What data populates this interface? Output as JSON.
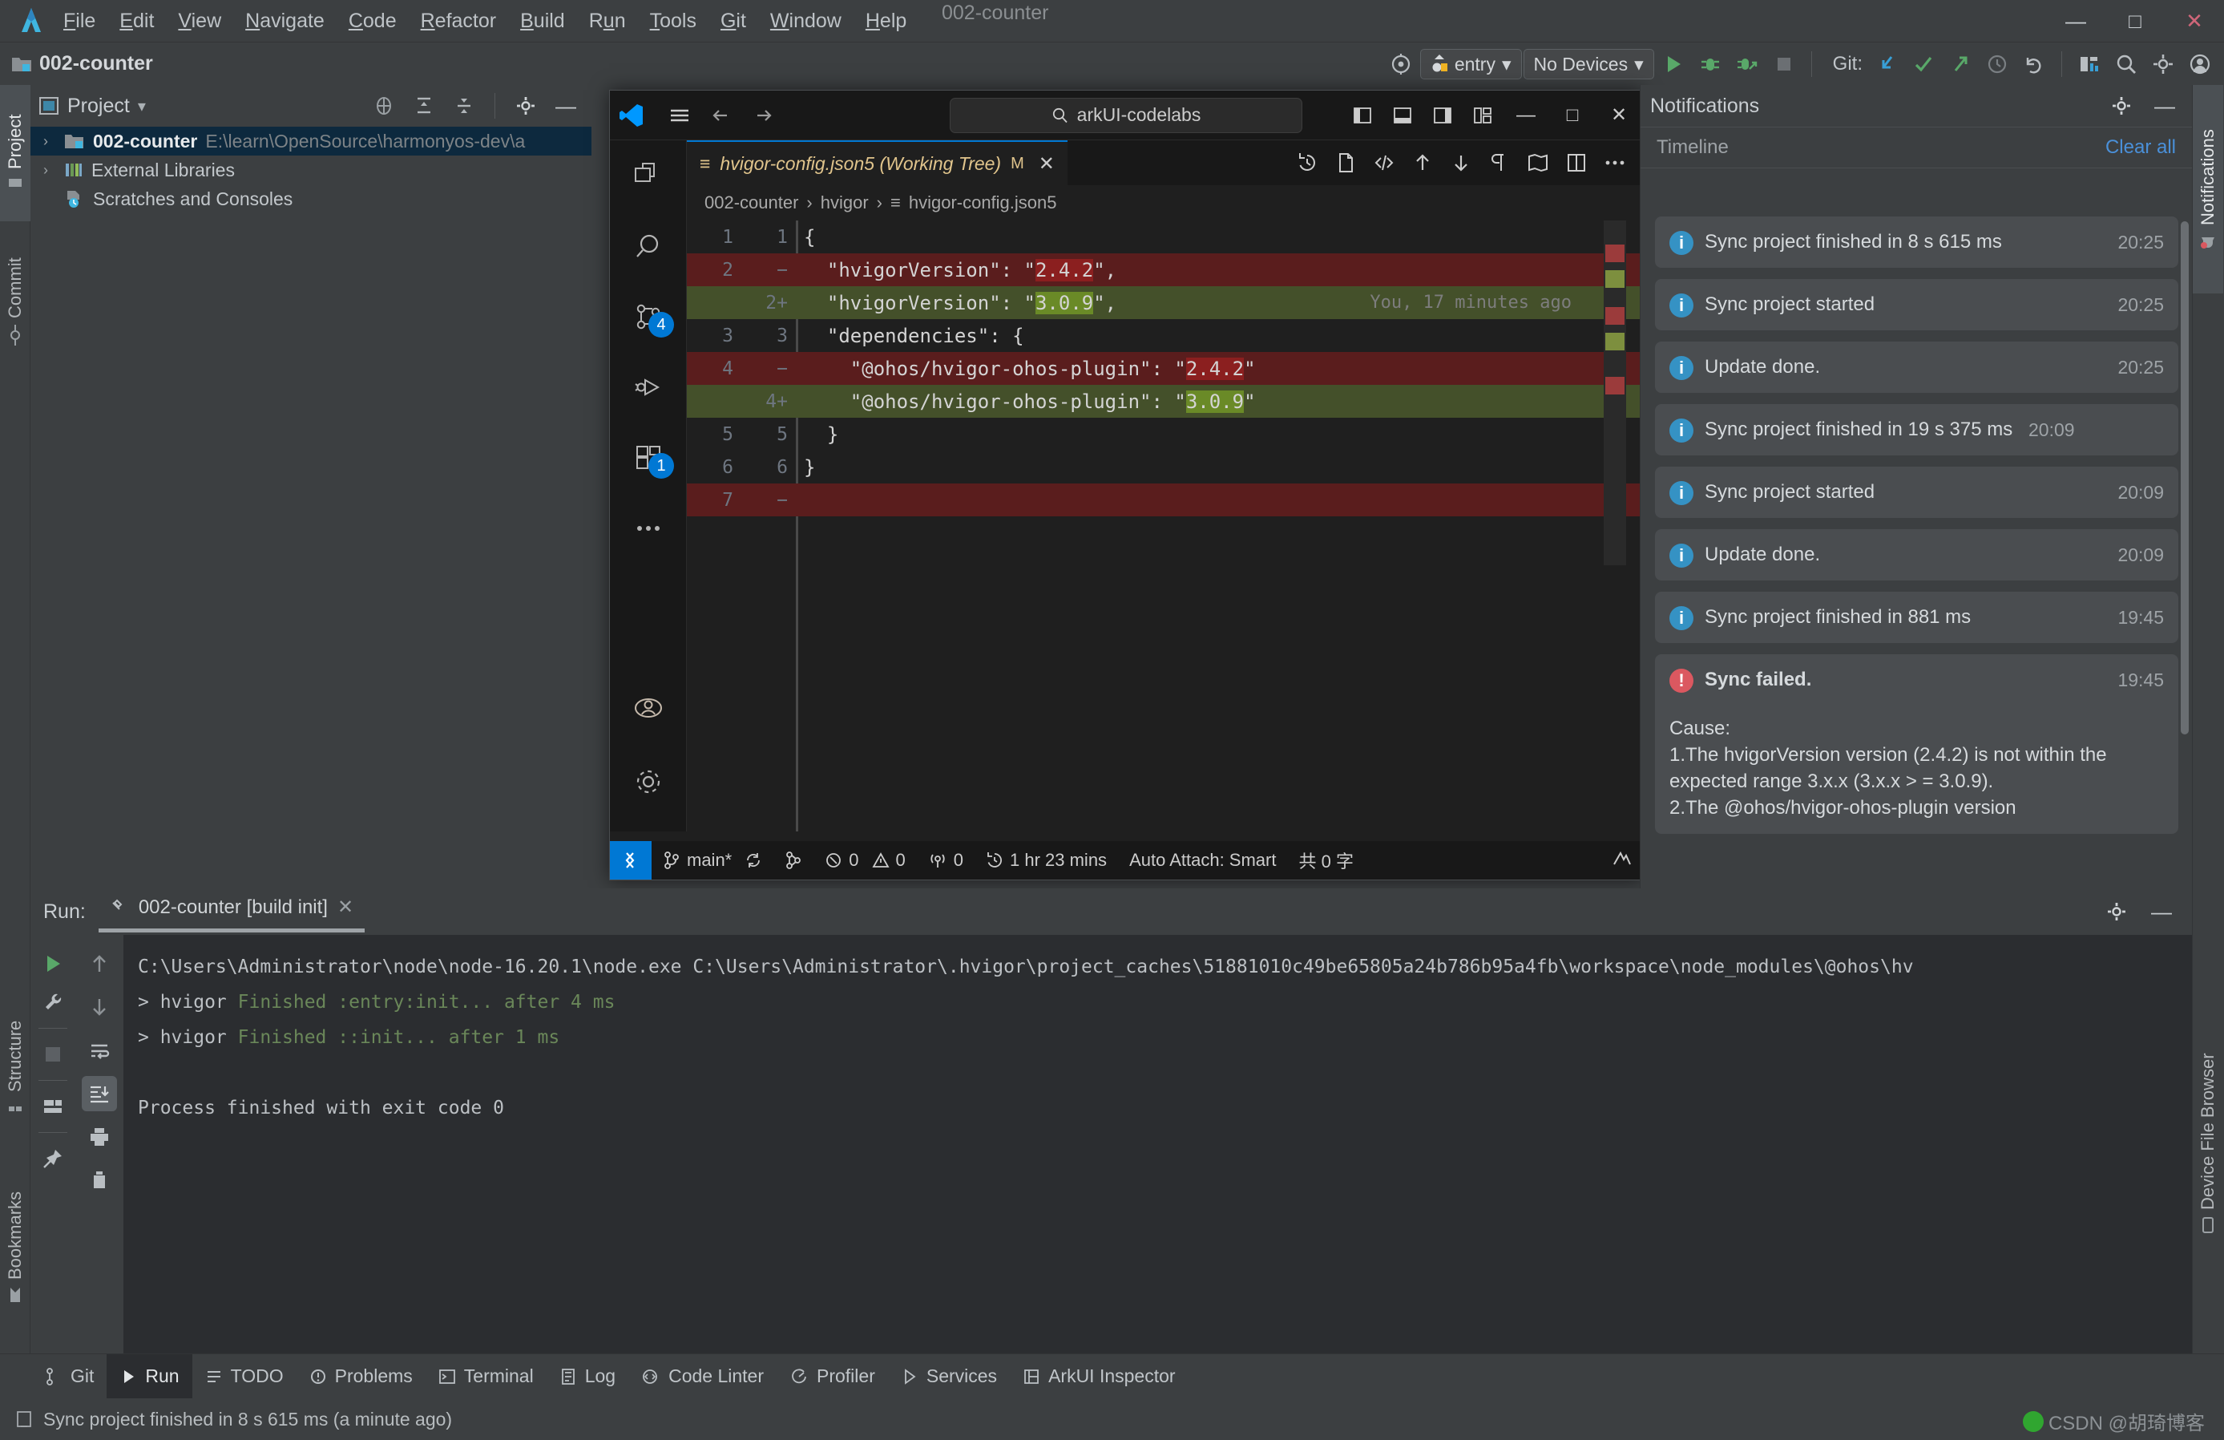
{
  "ide": {
    "menu": [
      "File",
      "Edit",
      "View",
      "Navigate",
      "Code",
      "Refactor",
      "Build",
      "Run",
      "Tools",
      "Git",
      "Window",
      "Help"
    ],
    "window_title": "002-counter",
    "project_chip": "002-counter",
    "toolbar": {
      "target_selector": "entry",
      "device_selector": "No Devices",
      "git_label": "Git:"
    },
    "left_tabs": [
      "Project",
      "Commit",
      "Structure",
      "Bookmarks"
    ],
    "right_tabs": [
      "Notifications",
      "Device File Browser"
    ]
  },
  "project_panel": {
    "title": "Project",
    "tree": [
      {
        "label": "002-counter",
        "path": "E:\\learn\\OpenSource\\harmonyos-dev\\a",
        "selected": true,
        "chevron": "›"
      },
      {
        "label": "External Libraries",
        "path": "",
        "selected": false,
        "chevron": "›"
      },
      {
        "label": "Scratches and Consoles",
        "path": "",
        "selected": false,
        "chevron": ""
      }
    ]
  },
  "vscode": {
    "search_value": "arkUI-codelabs",
    "tab": {
      "label": "hvigor-config.json5 (Working Tree)",
      "modified_flag": "M",
      "close": "✕"
    },
    "breadcrumb": [
      "002-counter",
      "hvigor",
      "hvigor-config.json5"
    ],
    "activity_badges": {
      "source_control": "4",
      "extensions": "1"
    },
    "diff": [
      {
        "old": "1",
        "new": "1",
        "type": "ctx",
        "text": "{"
      },
      {
        "old": "2",
        "new": "−",
        "type": "del",
        "pre": "  \"hvigorVersion\": \"",
        "hl": "2.4.2",
        "post": "\","
      },
      {
        "old": "",
        "new": "2+",
        "type": "add",
        "pre": "  \"hvigorVersion\": \"",
        "hl": "3.0.9",
        "post": "\",",
        "blame": "You, 17 minutes ago"
      },
      {
        "old": "3",
        "new": "3",
        "type": "ctx",
        "text": "  \"dependencies\": {"
      },
      {
        "old": "4",
        "new": "−",
        "type": "del",
        "pre": "    \"@ohos/hvigor-ohos-plugin\": \"",
        "hl": "2.4.2",
        "post": "\""
      },
      {
        "old": "",
        "new": "4+",
        "type": "add",
        "pre": "    \"@ohos/hvigor-ohos-plugin\": \"",
        "hl": "3.0.9",
        "post": "\""
      },
      {
        "old": "5",
        "new": "5",
        "type": "ctx",
        "text": "  }"
      },
      {
        "old": "6",
        "new": "6",
        "type": "ctx",
        "text": "}"
      },
      {
        "old": "7",
        "new": "−",
        "type": "del",
        "pre": "",
        "hl": "",
        "post": ""
      }
    ],
    "status": {
      "branch": "main*",
      "errors": "0",
      "warnings": "0",
      "ports": "0",
      "timer": "1 hr 23 mins",
      "auto_attach": "Auto Attach: Smart",
      "char_count": "共 0 字"
    }
  },
  "notifications": {
    "title": "Notifications",
    "section": "Timeline",
    "clear_all": "Clear all",
    "items": [
      {
        "kind": "info",
        "text": "Sync project finished in 8 s 615 ms",
        "time": "20:25",
        "bold": false
      },
      {
        "kind": "info",
        "text": "Sync project started",
        "time": "20:25",
        "bold": false
      },
      {
        "kind": "info",
        "text": "Update done.",
        "time": "20:25",
        "bold": false
      },
      {
        "kind": "info",
        "text": "Sync project finished in 19 s 375 ms",
        "time": "20:09",
        "bold": false
      },
      {
        "kind": "info",
        "text": "Sync project started",
        "time": "20:09",
        "bold": false
      },
      {
        "kind": "info",
        "text": "Update done.",
        "time": "20:09",
        "bold": false
      },
      {
        "kind": "info",
        "text": "Sync project finished in 881 ms",
        "time": "19:45",
        "bold": false
      },
      {
        "kind": "error",
        "text": "Sync failed.",
        "time": "19:45",
        "bold": true,
        "cause": "Cause:\n1.The hvigorVersion version (2.4.2) is not within the expected range 3.x.x (3.x.x > = 3.0.9).\n2.The @ohos/hvigor-ohos-plugin version"
      }
    ]
  },
  "run_panel": {
    "label": "Run:",
    "tab": "002-counter [build init]",
    "console": [
      {
        "type": "plain",
        "text": "C:\\Users\\Administrator\\node\\node-16.20.1\\node.exe C:\\Users\\Administrator\\.hvigor\\project_caches\\51881010c49be65805a24b786b95a4fb\\workspace\\node_modules\\@ohos\\hv"
      },
      {
        "type": "mixed",
        "pre": "> hvigor ",
        "green": "Finished :entry:init... after 4 ms",
        "post": ""
      },
      {
        "type": "mixed",
        "pre": "> hvigor ",
        "green": "Finished ::init... after 1 ms",
        "post": ""
      },
      {
        "type": "blank",
        "text": ""
      },
      {
        "type": "plain",
        "text": "Process finished with exit code 0"
      }
    ]
  },
  "bottom_bar": [
    {
      "label": "Git",
      "icon": "git-branch-icon",
      "active": false
    },
    {
      "label": "Run",
      "icon": "run-icon",
      "active": true
    },
    {
      "label": "TODO",
      "icon": "todo-icon",
      "active": false
    },
    {
      "label": "Problems",
      "icon": "problems-icon",
      "active": false
    },
    {
      "label": "Terminal",
      "icon": "terminal-icon",
      "active": false
    },
    {
      "label": "Log",
      "icon": "log-icon",
      "active": false
    },
    {
      "label": "Code Linter",
      "icon": "code-linter-icon",
      "active": false
    },
    {
      "label": "Profiler",
      "icon": "profiler-icon",
      "active": false
    },
    {
      "label": "Services",
      "icon": "services-icon",
      "active": false
    },
    {
      "label": "ArkUI Inspector",
      "icon": "arkui-inspector-icon",
      "active": false
    }
  ],
  "status_bar": {
    "message": "Sync project finished in 8 s 615 ms (a minute ago)"
  },
  "watermark": {
    "text": "CSDN @胡琦博客"
  },
  "colors": {
    "accent_blue": "#0078d4",
    "ide_bg": "#3c3f41",
    "vscode_bg": "#1f1f1f",
    "diff_add": "#44502a",
    "diff_del": "#5a1d1d",
    "error_red": "#db5860",
    "info_blue": "#3592c4",
    "console_green": "#6a8759"
  }
}
